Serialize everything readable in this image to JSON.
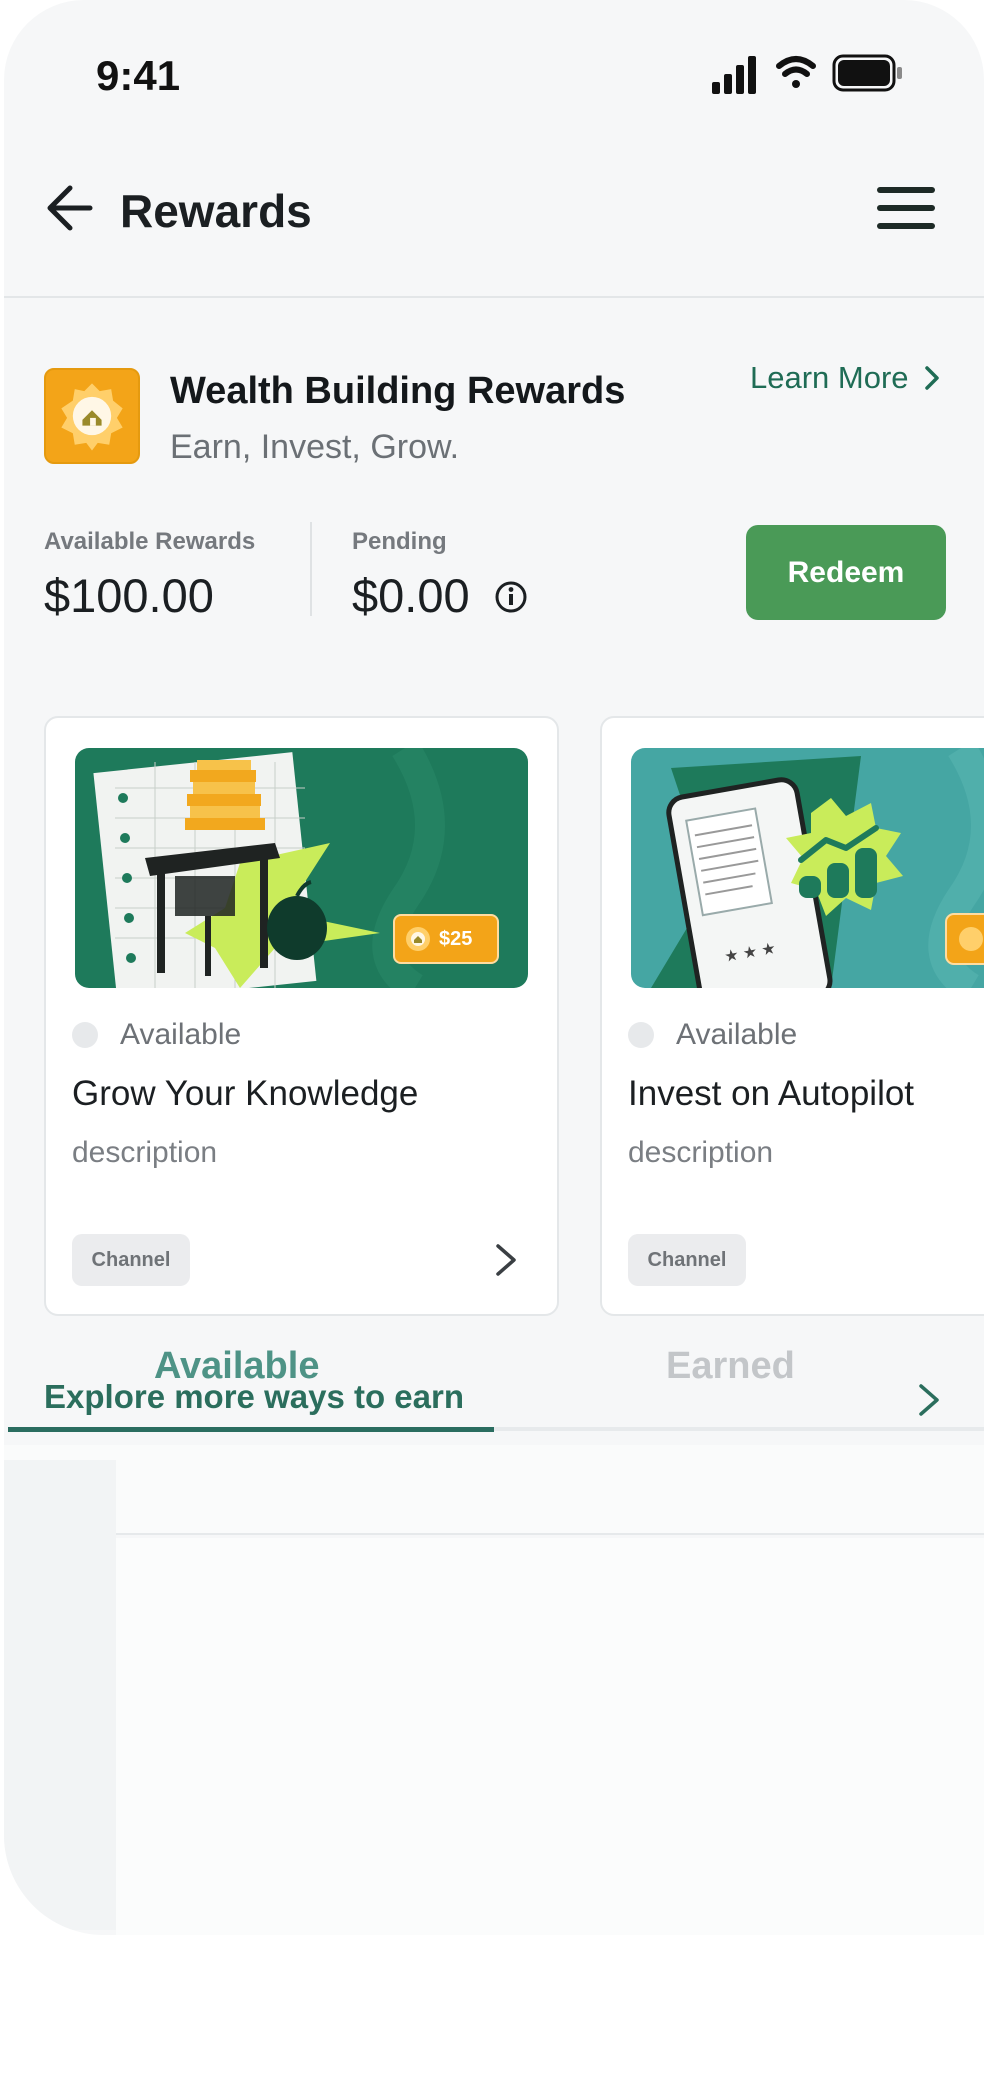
{
  "status_bar": {
    "time": "9:41",
    "icons": [
      "signal-icon",
      "wifi-icon",
      "battery-icon"
    ]
  },
  "app_bar": {
    "title": "Rewards",
    "back_icon": "arrow-left-icon",
    "menu_icon": "hamburger-menu-icon"
  },
  "program": {
    "title": "Wealth Building Rewards",
    "subtitle": "Earn, Invest, Grow.",
    "learn_more": "Learn More",
    "icon": "gold-seal-home-icon"
  },
  "balances": {
    "available_label": "Available Rewards",
    "available_value": "$100.00",
    "pending_label": "Pending",
    "pending_value": "$0.00",
    "redeem_label": "Redeem"
  },
  "cards": [
    {
      "status": "Available",
      "title": "Grow Your Knowledge",
      "description": "description",
      "channel": "Channel",
      "badge": "$25",
      "art_bg": "#1e7a5b"
    },
    {
      "status": "Available",
      "title": "Invest on Autopilot",
      "description": "description",
      "channel": "Channel",
      "art_bg": "#45a6a3"
    }
  ],
  "tabs": [
    {
      "label": "Available",
      "active": true
    },
    {
      "label": "Earned",
      "active": false
    }
  ],
  "explore": {
    "label": "Explore more ways to earn"
  },
  "colors": {
    "accent_green": "#1f6c55",
    "redeem_green": "#4a9a57",
    "gold": "#f3a418",
    "tab_active": "#4e9386"
  }
}
